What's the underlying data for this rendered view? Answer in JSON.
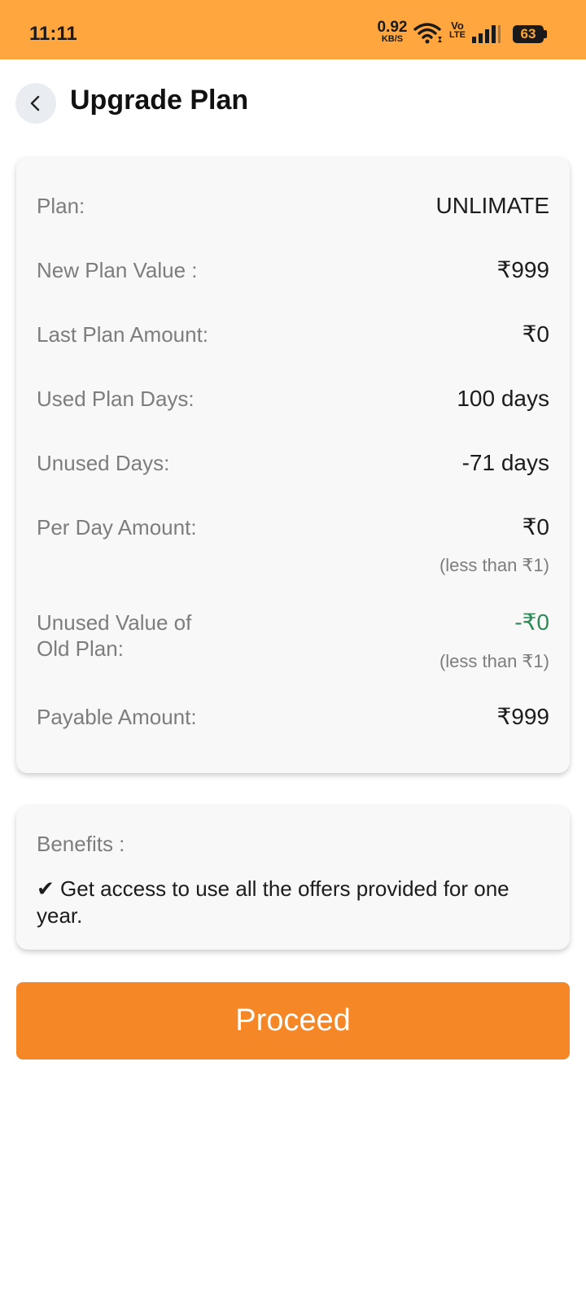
{
  "status_bar": {
    "time": "11:11",
    "net_speed_value": "0.92",
    "net_speed_unit": "KB/S",
    "volte_top": "Vo",
    "volte_bottom": "LTE",
    "battery": "63",
    "bg_color": "#ffa73e"
  },
  "header": {
    "title": "Upgrade Plan",
    "back_icon": "chevron-left-icon"
  },
  "summary": {
    "plan_label": "Plan:",
    "plan_value": "UNLIMATE",
    "new_plan_value_label": "New Plan Value :",
    "new_plan_value": "₹999",
    "last_plan_amount_label": "Last Plan Amount:",
    "last_plan_amount": "₹0",
    "used_plan_days_label": "Used Plan Days:",
    "used_plan_days": "100 days",
    "unused_days_label": "Unused Days:",
    "unused_days": "-71 days",
    "per_day_amount_label": "Per Day Amount:",
    "per_day_amount": "₹0",
    "per_day_amount_note": "(less than ₹1)",
    "unused_value_label_line1": "Unused Value of",
    "unused_value_label_line2": "Old Plan:",
    "unused_value": "-₹0",
    "unused_value_note": "(less than ₹1)",
    "payable_amount_label": "Payable Amount:",
    "payable_amount": "₹999"
  },
  "benefits": {
    "title": "Benefits :",
    "check_icon": "checkmark-icon",
    "items": [
      "Get access to use all the offers provided for one year."
    ]
  },
  "proceed_button": {
    "label": "Proceed",
    "color": "#f58727"
  },
  "colors": {
    "accent": "#f58727",
    "negative_value": "#2e8b57"
  }
}
